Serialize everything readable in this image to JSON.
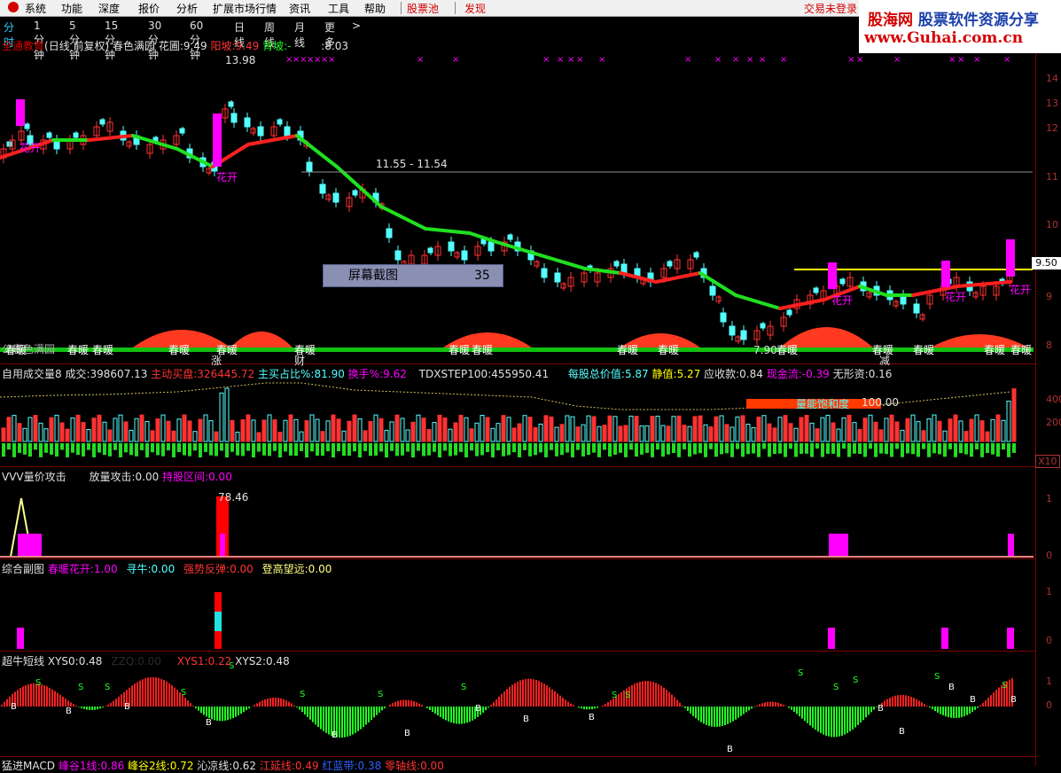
{
  "menubar": {
    "items": [
      "系统",
      "功能",
      "深度",
      "报价",
      "分析",
      "扩展市场行情",
      "资讯",
      "工具",
      "帮助"
    ],
    "stock_pool": "股票池",
    "alert": "发现",
    "login": "交易未登录"
  },
  "logo": {
    "brand": "股海网",
    "tagline": "股票软件资源分享",
    "url": "www.Guhai.com.cn"
  },
  "periods": {
    "items": [
      "分时",
      "1分钟",
      "5分钟",
      "15分钟",
      "30分钟",
      "60分钟",
      "日线",
      "周线",
      "月线",
      "更多"
    ],
    "active": "分时"
  },
  "main_panel": {
    "indicator_name": "全通教育",
    "mode": "(日线 前复权)",
    "formula": "春色满园",
    "flower_label": "花圃:",
    "flower_value": "9.49",
    "yang_label": "阳坡:",
    "yang_value": "9.49",
    "bei_label": "背坡:",
    "bei_value": "-",
    "extra_value": ":8.03",
    "high_marker": "13.98",
    "low_marker": "7.90",
    "resistance_text": "11.55 - 11.54",
    "current_price": "9.50",
    "screenshot_label": "屏幕截图",
    "screenshot_count": "35",
    "flower_open": "花开",
    "spring_warm": "春暖",
    "rise": "涨",
    "wealth": "财",
    "reduce": "减",
    "bottom_text": "公春色满园",
    "price_axis": [
      "14",
      "13",
      "12",
      "11",
      "10",
      "9",
      "8"
    ]
  },
  "volume_panel": {
    "title": "自用成交量8",
    "vol_label": "成交:",
    "vol_value": "398607.13",
    "active_buy_label": "主动买盘:",
    "active_buy_value": "326445.72",
    "ratio_label": "主买占比%:",
    "ratio_value": "81.90",
    "turnover_label": "换手%:",
    "turnover_value": "9.62",
    "step_label": "TDXSTEP100:",
    "step_value": "455950.41",
    "nav_label": "每股总价值:",
    "nav_value": "5.87",
    "net_label": "静值:",
    "net_value": "5.27",
    "receivable_label": "应收款:",
    "receivable_value": "0.84",
    "cash_label": "现金流:",
    "cash_value": "-0.39",
    "intangible_label": "无形资:",
    "intangible_value": "0.16",
    "saturation_label": "量能饱和度",
    "saturation_value": "100.00",
    "axis": [
      "400",
      "200"
    ],
    "unit": "X10"
  },
  "attack_panel": {
    "title": "VVV量价攻击",
    "attack_label": "放量攻击:",
    "attack_value": "0.00",
    "hold_label": "持股区间:",
    "hold_value": "0.00",
    "peak_value": "78.46",
    "axis": [
      "1",
      "0"
    ]
  },
  "composite_panel": {
    "title": "综合副图",
    "spring_label": "春暖花开:",
    "spring_value": "1.00",
    "bull_label": "寻牛:",
    "bull_value": "0.00",
    "rebound_label": "强势反弹:",
    "rebound_value": "0.00",
    "peak_label": "登高望远:",
    "peak_value": "0.00",
    "axis": [
      "1",
      "0"
    ]
  },
  "bull_panel": {
    "title": "超牛短线",
    "xys0_label": "XYS0:",
    "xys0_value": "0.48",
    "ghost_text": "ZZQ:0.00",
    "xys1_label": "XYS1:",
    "xys1_value": "0.22",
    "xys2_label": "XYS2:",
    "xys2_value": "0.48",
    "axis": [
      "1",
      "0"
    ]
  },
  "macd_panel": {
    "title": "猛进MACD",
    "l1_label": "峰谷1线:",
    "l1_value": "0.86",
    "l2_label": "峰谷2线:",
    "l2_value": "0.72",
    "l3_label": "沁凉线:",
    "l3_value": "0.62",
    "l4_label": "江延线:",
    "l4_value": "0.49",
    "l5_label": "红蓝带:",
    "l5_value": "0.38",
    "l6_label": "零轴线:",
    "l6_value": "0.00"
  },
  "colors": {
    "up": "#ff3232",
    "down": "#54ffff",
    "ma_up": "#ff2020",
    "ma_down": "#20e020",
    "magenta": "#ff00ff",
    "yellow": "#ffff00",
    "green": "#22ff22"
  }
}
